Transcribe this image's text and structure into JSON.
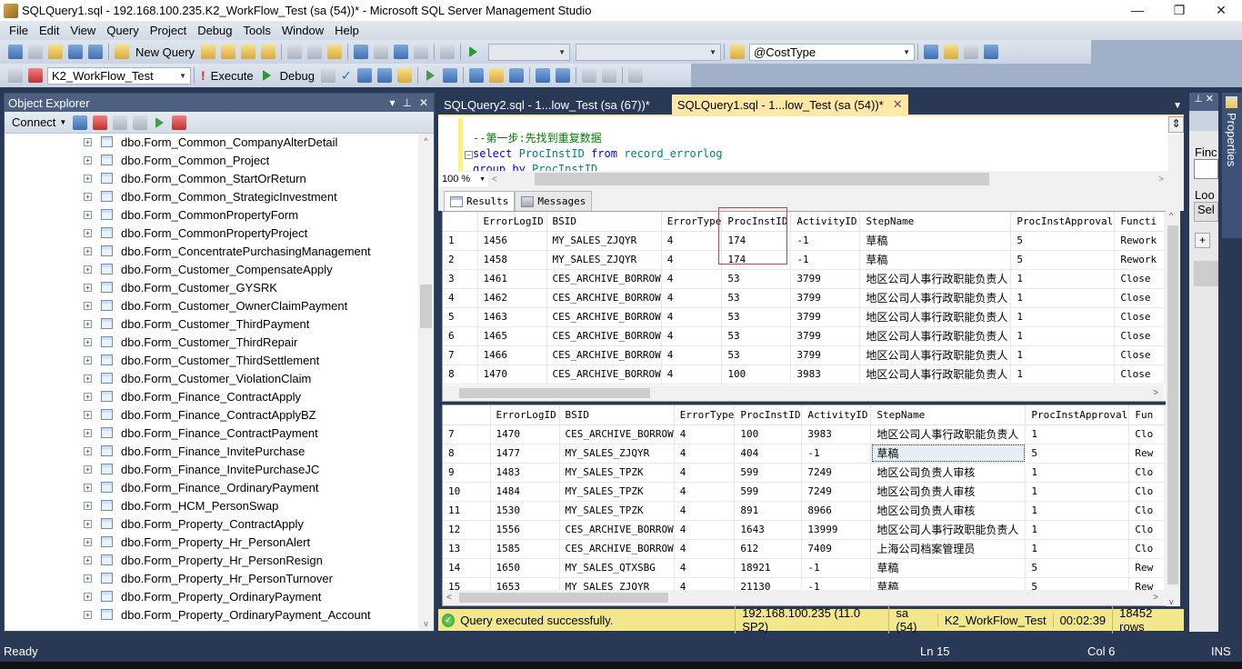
{
  "window": {
    "title": "SQLQuery1.sql - 192.168.100.235.K2_WorkFlow_Test (sa (54))* - Microsoft SQL Server Management Studio",
    "controls": {
      "minimize": "—",
      "restore": "❐",
      "close": "✕"
    }
  },
  "menu": [
    "File",
    "Edit",
    "View",
    "Query",
    "Project",
    "Debug",
    "Tools",
    "Window",
    "Help"
  ],
  "toolbar1": {
    "new_query_label": "New Query",
    "parameter_combo": "@CostType"
  },
  "toolbar2": {
    "database_combo": "K2_WorkFlow_Test",
    "execute_label": "Execute",
    "debug_label": "Debug"
  },
  "object_explorer": {
    "title": "Object Explorer",
    "connect_label": "Connect",
    "nodes": [
      "dbo.Form_Common_CompanyAlterDetail",
      "dbo.Form_Common_Project",
      "dbo.Form_Common_StartOrReturn",
      "dbo.Form_Common_StrategicInvestment",
      "dbo.Form_CommonPropertyForm",
      "dbo.Form_CommonPropertyProject",
      "dbo.Form_ConcentratePurchasingManagement",
      "dbo.Form_Customer_CompensateApply",
      "dbo.Form_Customer_GYSRK",
      "dbo.Form_Customer_OwnerClaimPayment",
      "dbo.Form_Customer_ThirdPayment",
      "dbo.Form_Customer_ThirdRepair",
      "dbo.Form_Customer_ThirdSettlement",
      "dbo.Form_Customer_ViolationClaim",
      "dbo.Form_Finance_ContractApply",
      "dbo.Form_Finance_ContractApplyBZ",
      "dbo.Form_Finance_ContractPayment",
      "dbo.Form_Finance_InvitePurchase",
      "dbo.Form_Finance_InvitePurchaseJC",
      "dbo.Form_Finance_OrdinaryPayment",
      "dbo.Form_HCM_PersonSwap",
      "dbo.Form_Property_ContractApply",
      "dbo.Form_Property_Hr_PersonAlert",
      "dbo.Form_Property_Hr_PersonResign",
      "dbo.Form_Property_Hr_PersonTurnover",
      "dbo.Form_Property_OrdinaryPayment",
      "dbo.Form_Property_OrdinaryPayment_Account"
    ]
  },
  "doc_tabs": [
    {
      "label": "SQLQuery2.sql - 1...low_Test (sa (67))*",
      "active": false
    },
    {
      "label": "SQLQuery1.sql - 1...low_Test (sa (54))*",
      "active": true
    }
  ],
  "editor": {
    "line1": "--第一步:先找到重复数据",
    "line2_kw1": "select",
    "line2_id1": "ProcInstID",
    "line2_kw2": "from",
    "line2_id2": "record_errorlog",
    "line3_kw": "group by",
    "line3_id": "ProcInstID",
    "zoom": "100 %"
  },
  "result_tabs": {
    "results": "Results",
    "messages": "Messages"
  },
  "grid1": {
    "columns": [
      "",
      "ErrorLogID",
      "BSID",
      "ErrorType",
      "ProcInstID",
      "ActivityID",
      "StepName",
      "ProcInstApproval",
      "Functi"
    ],
    "rows": [
      [
        "1",
        "1456",
        "MY_SALES_ZJQYR",
        "4",
        "174",
        "-1",
        "草稿",
        "5",
        "Rework"
      ],
      [
        "2",
        "1458",
        "MY_SALES_ZJQYR",
        "4",
        "174",
        "-1",
        "草稿",
        "5",
        "Rework"
      ],
      [
        "3",
        "1461",
        "CES_ARCHIVE_BORROW",
        "4",
        "53",
        "3799",
        "地区公司人事行政职能负责人",
        "1",
        "Close"
      ],
      [
        "4",
        "1462",
        "CES_ARCHIVE_BORROW",
        "4",
        "53",
        "3799",
        "地区公司人事行政职能负责人",
        "1",
        "Close"
      ],
      [
        "5",
        "1463",
        "CES_ARCHIVE_BORROW",
        "4",
        "53",
        "3799",
        "地区公司人事行政职能负责人",
        "1",
        "Close"
      ],
      [
        "6",
        "1465",
        "CES_ARCHIVE_BORROW",
        "4",
        "53",
        "3799",
        "地区公司人事行政职能负责人",
        "1",
        "Close"
      ],
      [
        "7",
        "1466",
        "CES_ARCHIVE_BORROW",
        "4",
        "53",
        "3799",
        "地区公司人事行政职能负责人",
        "1",
        "Close"
      ],
      [
        "8",
        "1470",
        "CES_ARCHIVE_BORROW",
        "4",
        "100",
        "3983",
        "地区公司人事行政职能负责人",
        "1",
        "Close"
      ]
    ]
  },
  "grid2": {
    "columns": [
      "",
      "ErrorLogID",
      "BSID",
      "ErrorType",
      "ProcInstID",
      "ActivityID",
      "StepName",
      "ProcInstApproval",
      "Fun"
    ],
    "rows": [
      [
        "7",
        "1470",
        "CES_ARCHIVE_BORROW",
        "4",
        "100",
        "3983",
        "地区公司人事行政职能负责人",
        "1",
        "Clo"
      ],
      [
        "8",
        "1477",
        "MY_SALES_ZJQYR",
        "4",
        "404",
        "-1",
        "草稿",
        "5",
        "Rew"
      ],
      [
        "9",
        "1483",
        "MY_SALES_TPZK",
        "4",
        "599",
        "7249",
        "地区公司负责人审核",
        "1",
        "Clo"
      ],
      [
        "10",
        "1484",
        "MY_SALES_TPZK",
        "4",
        "599",
        "7249",
        "地区公司负责人审核",
        "1",
        "Clo"
      ],
      [
        "11",
        "1530",
        "MY_SALES_TPZK",
        "4",
        "891",
        "8966",
        "地区公司负责人审核",
        "1",
        "Clo"
      ],
      [
        "12",
        "1556",
        "CES_ARCHIVE_BORROW",
        "4",
        "1643",
        "13999",
        "地区公司人事行政职能负责人",
        "1",
        "Clo"
      ],
      [
        "13",
        "1585",
        "CES_ARCHIVE_BORROW",
        "4",
        "612",
        "7409",
        "上海公司档案管理员",
        "1",
        "Clo"
      ],
      [
        "14",
        "1650",
        "MY_SALES_QTXSBG",
        "4",
        "18921",
        "-1",
        "草稿",
        "5",
        "Rew"
      ],
      [
        "15",
        "1653",
        "MY_SALES_ZJQYR",
        "4",
        "21130",
        "-1",
        "草稿",
        "5",
        "Rew"
      ]
    ],
    "selected_row": 1
  },
  "query_status": {
    "message": "Query executed successfully.",
    "server": "192.168.100.235 (11.0 SP2)",
    "user": "sa (54)",
    "database": "K2_WorkFlow_Test",
    "elapsed": "00:02:39",
    "rows": "18452 rows"
  },
  "properties_panel": {
    "side_label": "Properties",
    "find_label": "Finc",
    "look_label": "Loo",
    "select_label": "Sel",
    "plus": "+"
  },
  "statusbar": {
    "state": "Ready",
    "line": "Ln 15",
    "col": "Col 6",
    "mode": "INS"
  }
}
